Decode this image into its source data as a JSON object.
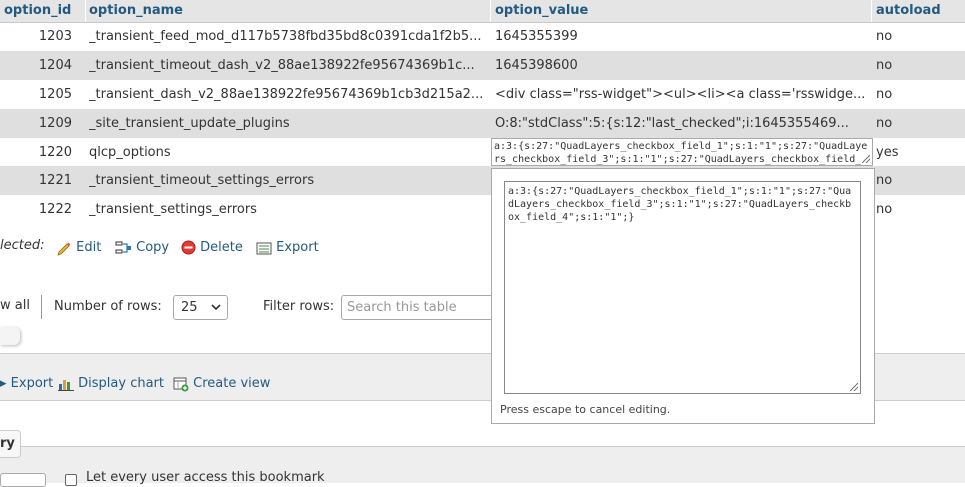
{
  "table": {
    "headers": [
      "option_id",
      "option_name",
      "option_value",
      "autoload"
    ],
    "rows": [
      {
        "id": "1203",
        "name": "_transient_feed_mod_d117b5738fbd35bd8c0391cda1f2b5...",
        "value": "1645355399",
        "autoload": "no"
      },
      {
        "id": "1204",
        "name": "_transient_timeout_dash_v2_88ae138922fe95674369b1c...",
        "value": "1645398600",
        "autoload": "no"
      },
      {
        "id": "1205",
        "name": "_transient_dash_v2_88ae138922fe95674369b1cb3d215a2...",
        "value": "<div class=\"rss-widget\"><ul><li><a class='rsswidge...",
        "autoload": "no"
      },
      {
        "id": "1209",
        "name": "_site_transient_update_plugins",
        "value": "O:8:\"stdClass\":5:{s:12:\"last_checked\";i:1645355469...",
        "autoload": "no"
      },
      {
        "id": "1220",
        "name": "qlcp_options",
        "value": "",
        "autoload": "yes"
      },
      {
        "id": "1221",
        "name": "_transient_timeout_settings_errors",
        "value": "",
        "autoload": "no"
      },
      {
        "id": "1222",
        "name": "_transient_settings_errors",
        "value": "",
        "autoload": "no"
      }
    ]
  },
  "inline_edit": {
    "value": "a:3:{s:27:\"QuadLayers_checkbox_field_1\";s:1:\"1\";s:27:\"QuadLayers_checkbox_field_3\";s:1:\"1\";s:27:\"QuadLayers_checkbox_field_4\";s:1:\"1\";}"
  },
  "popup": {
    "value": "a:3:{s:27:\"QuadLayers_checkbox_field_1\";s:1:\"1\";s:27:\"QuadLayers_checkbox_field_3\";s:1:\"1\";s:27:\"QuadLayers_checkbox_field_4\";s:1:\"1\";}",
    "note": "Press escape to cancel editing."
  },
  "selected_actions": {
    "label": "lected:",
    "edit": "Edit",
    "copy": "Copy",
    "delete": "Delete",
    "export": "Export"
  },
  "nav": {
    "show_all": "w all",
    "rows_label": "Number of rows:",
    "rows_value": "25",
    "filter_label": "Filter rows:",
    "filter_placeholder": "Search this table"
  },
  "operations": {
    "export": "Export",
    "display_chart": "Display chart",
    "create_view": "Create view"
  },
  "bookmark": {
    "query_tab": "ry",
    "checkbox_label": "Let every user access this bookmark"
  },
  "colors": {
    "link": "#235a81",
    "header_bg": "#e5e5e5",
    "row_alt_bg": "#dfdfdf",
    "delete_red": "#e53935"
  }
}
